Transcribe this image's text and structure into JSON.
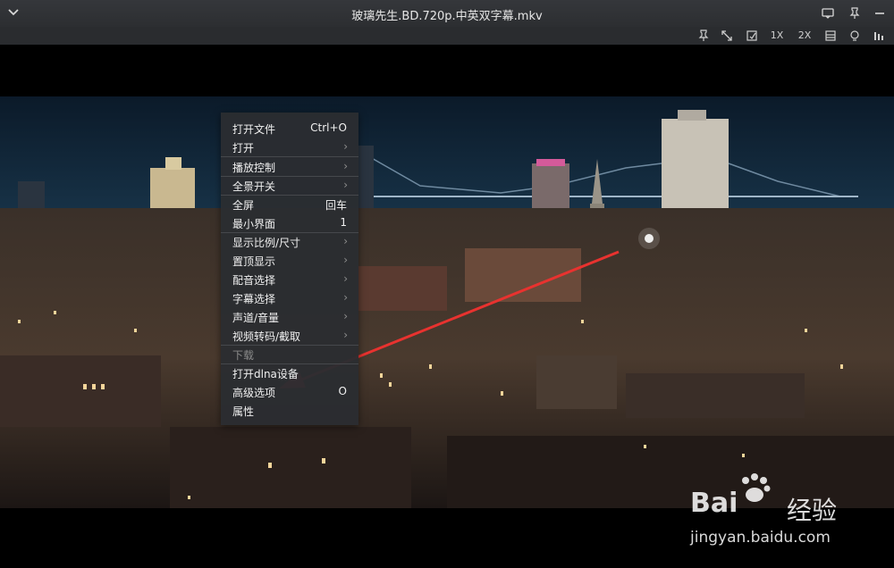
{
  "window": {
    "title": "玻璃先生.BD.720p.中英双字幕.mkv"
  },
  "toolbar": {
    "speed_1x": "1X",
    "speed_2x": "2X"
  },
  "menu": {
    "items": [
      {
        "label": "打开文件",
        "shortcut": "Ctrl+O"
      },
      {
        "label": "打开",
        "submenu": true
      },
      {
        "label": "播放控制",
        "submenu": true
      },
      {
        "label": "全景开关",
        "submenu": true
      },
      {
        "label": "全屏",
        "shortcut": "回车"
      },
      {
        "label": "最小界面",
        "shortcut": "1"
      },
      {
        "label": "显示比例/尺寸",
        "submenu": true
      },
      {
        "label": "置顶显示",
        "submenu": true
      },
      {
        "label": "配音选择",
        "submenu": true
      },
      {
        "label": "字幕选择",
        "submenu": true
      },
      {
        "label": "声道/音量",
        "submenu": true
      },
      {
        "label": "视频转码/截取",
        "submenu": true
      },
      {
        "label": "下载",
        "disabled": true
      },
      {
        "label": "打开dlna设备"
      },
      {
        "label": "高级选项",
        "shortcut": "O"
      },
      {
        "label": "属性"
      }
    ]
  },
  "watermark": {
    "brand": "Bai",
    "brand2": "经验",
    "url": "jingyan.baidu.com"
  },
  "colors": {
    "arrow": "#e8322f",
    "menu_bg": "#2b2d31",
    "titlebar_bg": "#2f3134"
  }
}
